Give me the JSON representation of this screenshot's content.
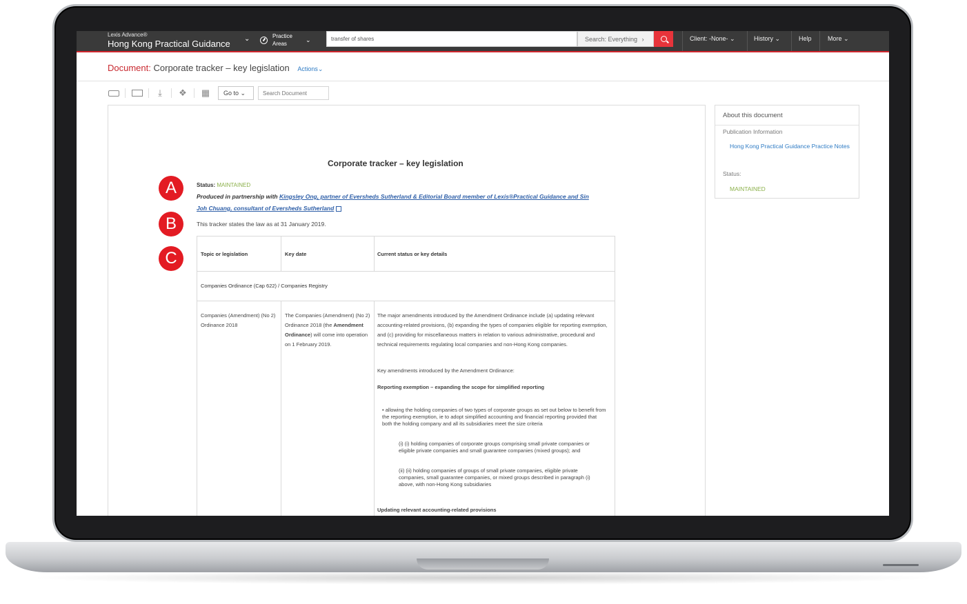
{
  "brand": {
    "small": "Lexis Advance®",
    "product": "Hong Kong Practical Guidance"
  },
  "nav": {
    "practice_areas": "Practice Areas",
    "search_value": "transfer of shares",
    "search_scope": "Search: Everything",
    "client": "Client: -None-",
    "history": "History",
    "help": "Help",
    "more": "More"
  },
  "doc": {
    "label": "Document:",
    "title": "Corporate tracker – key legislation",
    "actions": "Actions"
  },
  "toolbar": {
    "goto": "Go to",
    "search_placeholder": "Search Document"
  },
  "content": {
    "heading": "Corporate tracker – key legislation",
    "status_label": "Status:",
    "status_value": "MAINTAINED",
    "produced_prefix": "Produced in partnership with",
    "produced_link": "Kingsley Ong, partner of Eversheds Sutherland & Editorial Board member of Lexis®Practical Guidance and Sin Joh Chuang, consultant of Eversheds Sutherland",
    "tracker_note": "This tracker states the law as at 31 January 2019."
  },
  "markers": [
    "A",
    "B",
    "C"
  ],
  "table": {
    "headers": [
      "Topic or legislation",
      "Key date",
      "Current status or key details"
    ],
    "section": "Companies Ordinance (Cap 622) / Companies Registry",
    "row": {
      "topic": "Companies (Amendment) (No 2) Ordinance 2018",
      "date_pre": "The Companies (Amendment) (No 2) Ordinance 2018 (the",
      "date_bold": "Amendment Ordinance",
      "date_post": ") will come into operation on 1 February 2019.",
      "detail_intro": "The major amendments introduced by the Amendment Ordinance include (a) updating relevant accounting-related provisions, (b) expanding the types of companies eligible for reporting exemption, and (c) providing for miscellaneous matters in relation to various administrative, procedural and technical requirements regulating local companies and non-Hong Kong companies.",
      "key_amend": "Key amendments introduced by the Amendment Ordinance:",
      "subhead1": "Reporting exemption – expanding the scope for simplified reporting",
      "bullet": "allowing the holding companies of two types of corporate groups as set out below to benefit from the reporting exemption, ie to adopt simplified accounting and financial reporting provided that both the holding company and all its subsidiaries meet the size criteria",
      "sub_i": "(i) (i) holding companies of corporate groups comprising small private companies or eligible private companies and small guarantee companies (mixed groups); and",
      "sub_ii": "(ii) (ii) holding companies of groups of small private companies, eligible private companies, small guarantee companies, or mixed groups described in paragraph (i) above, with non-Hong Kong subsidiaries",
      "subhead2": "Updating relevant accounting-related provisions"
    }
  },
  "sidebar": {
    "title": "About this document",
    "pub_info": "Publication Information",
    "pub_link": "Hong Kong Practical Guidance Practice Notes",
    "status_label": "Status:",
    "status_value": "MAINTAINED"
  },
  "colors": {
    "brand_red": "#d0262d",
    "link_blue": "#2e7bc4",
    "status_green": "#8bb04a",
    "marker_red": "#e31b23"
  }
}
